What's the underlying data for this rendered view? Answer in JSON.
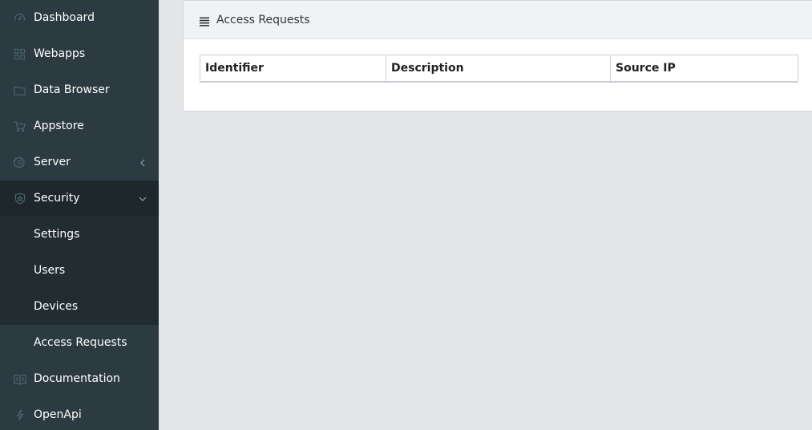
{
  "sidebar": {
    "items": [
      {
        "label": "Dashboard",
        "icon": "dashboard-icon"
      },
      {
        "label": "Webapps",
        "icon": "grid-icon"
      },
      {
        "label": "Data Browser",
        "icon": "folder-icon"
      },
      {
        "label": "Appstore",
        "icon": "cart-icon"
      },
      {
        "label": "Server",
        "icon": "gear-icon"
      },
      {
        "label": "Security",
        "icon": "shield-icon"
      },
      {
        "label": "Documentation",
        "icon": "book-icon"
      },
      {
        "label": "OpenApi",
        "icon": "bolt-icon"
      }
    ],
    "security_submenu": [
      {
        "label": "Settings"
      },
      {
        "label": "Users"
      },
      {
        "label": "Devices"
      },
      {
        "label": "Access Requests",
        "active": true
      }
    ]
  },
  "main": {
    "title": "Access Requests",
    "title_icon": "list-icon",
    "table": {
      "columns": [
        "Identifier",
        "Description",
        "Source IP"
      ],
      "rows": []
    }
  },
  "colors": {
    "sidebar_bg": "#2c3b41",
    "submenu_bg": "#222d32",
    "active_bg": "#2c3b41",
    "page_bg": "#e4e5e7",
    "icon_color": "#4b646f"
  }
}
